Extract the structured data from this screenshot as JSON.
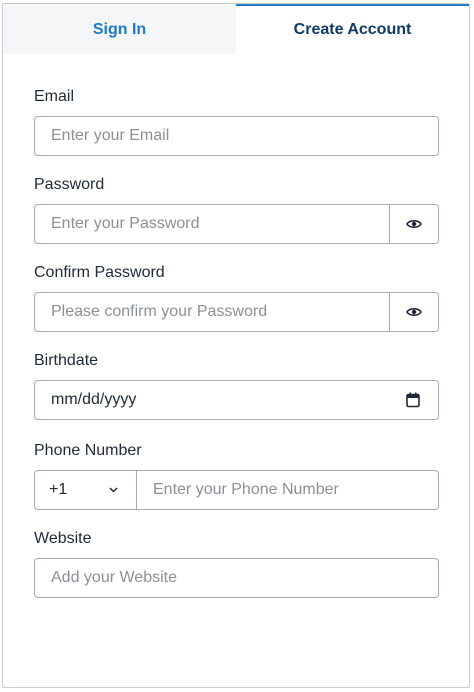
{
  "tabs": [
    {
      "label": "Sign In"
    },
    {
      "label": "Create Account"
    }
  ],
  "email": {
    "label": "Email",
    "placeholder": "Enter your Email"
  },
  "password": {
    "label": "Password",
    "placeholder": "Enter your Password",
    "toggle_icon": "eye-icon"
  },
  "confirm_password": {
    "label": "Confirm Password",
    "placeholder": "Please confirm your Password",
    "toggle_icon": "eye-icon"
  },
  "birthdate": {
    "label": "Birthdate",
    "value": "mm/dd/yyyy",
    "icon": "calendar-icon"
  },
  "phone": {
    "label": "Phone Number",
    "country_code": "+1",
    "placeholder": "Enter your Phone Number",
    "chevron_icon": "chevron-down-icon"
  },
  "website": {
    "label": "Website",
    "placeholder": "Add your Website"
  },
  "colors": {
    "accent": "#1f7cc6",
    "tab_active_text": "#0f3b66",
    "tab_inactive_text": "#1d7ac4",
    "border": "#a7acb3"
  }
}
